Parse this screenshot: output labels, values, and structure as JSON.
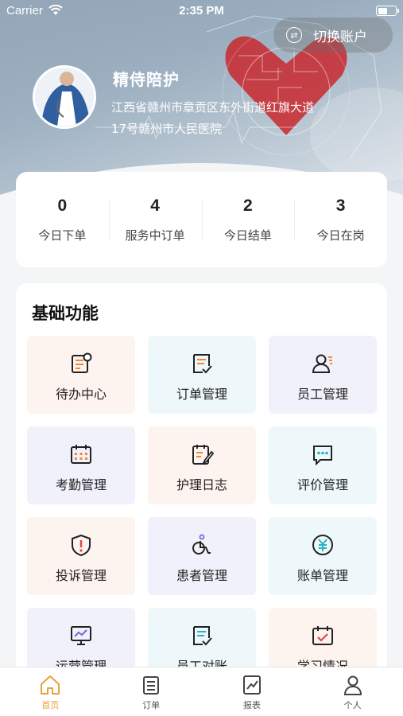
{
  "status_bar": {
    "carrier": "Carrier",
    "time": "2:35 PM"
  },
  "header": {
    "switch_account_label": "切换账户",
    "org_name": "精侍陪护",
    "address": "江西省赣州市章贡区东外街道红旗大道17号赣州市人民医院"
  },
  "stats": [
    {
      "value": "0",
      "label": "今日下单"
    },
    {
      "value": "4",
      "label": "服务中订单"
    },
    {
      "value": "2",
      "label": "今日结单"
    },
    {
      "value": "3",
      "label": "今日在岗"
    }
  ],
  "features": {
    "title": "基础功能",
    "items": [
      {
        "label": "待办中心",
        "icon": "todo-icon"
      },
      {
        "label": "订单管理",
        "icon": "order-icon"
      },
      {
        "label": "员工管理",
        "icon": "staff-icon"
      },
      {
        "label": "考勤管理",
        "icon": "attendance-icon"
      },
      {
        "label": "护理日志",
        "icon": "nursing-log-icon"
      },
      {
        "label": "评价管理",
        "icon": "review-icon"
      },
      {
        "label": "投诉管理",
        "icon": "complaint-icon"
      },
      {
        "label": "患者管理",
        "icon": "patient-icon"
      },
      {
        "label": "账单管理",
        "icon": "bill-icon"
      },
      {
        "label": "运营管理",
        "icon": "operation-icon"
      },
      {
        "label": "员工对账",
        "icon": "reconcile-icon"
      },
      {
        "label": "学习情况",
        "icon": "study-icon"
      }
    ]
  },
  "tabbar": [
    {
      "label": "首页",
      "icon": "home-icon"
    },
    {
      "label": "订单",
      "icon": "order-list-icon"
    },
    {
      "label": "报表",
      "icon": "report-icon"
    },
    {
      "label": "个人",
      "icon": "profile-icon"
    }
  ],
  "colors": {
    "accent": "#e6a23c",
    "icon_dark": "#222222",
    "icon_accent": "#f0883a"
  }
}
